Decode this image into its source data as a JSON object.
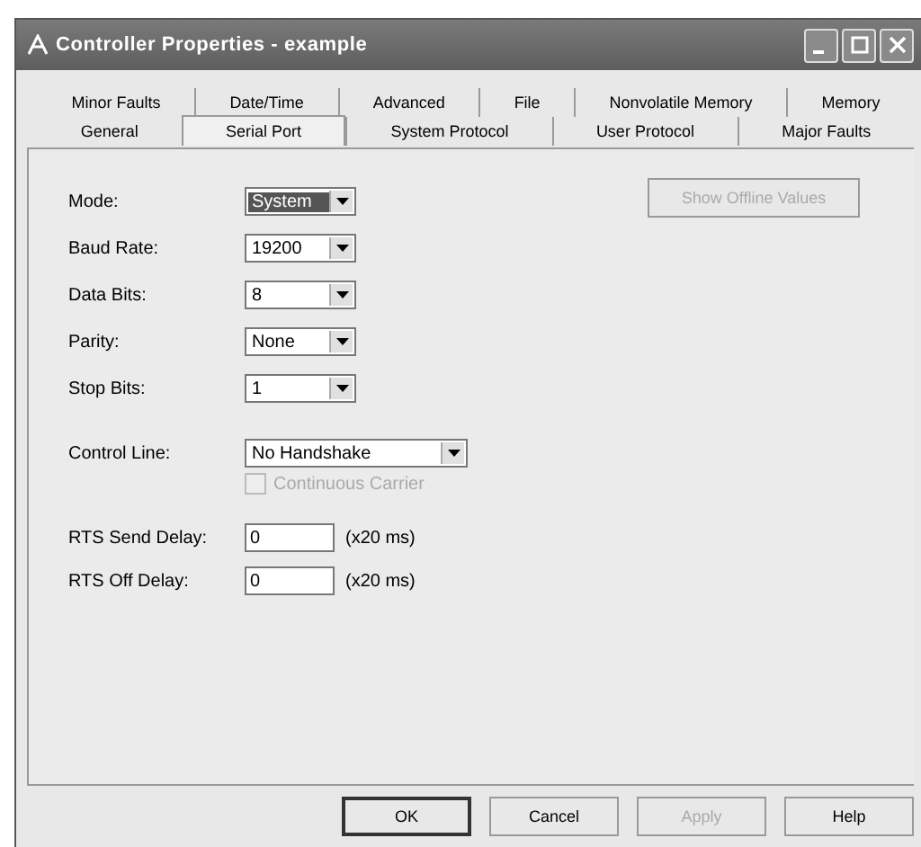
{
  "window": {
    "title": "Controller Properties - example"
  },
  "tab_rows": [
    [
      {
        "label": "Minor Faults",
        "selected": false
      },
      {
        "label": "Date/Time",
        "selected": false
      },
      {
        "label": "Advanced",
        "selected": false
      },
      {
        "label": "File",
        "selected": false
      },
      {
        "label": "Nonvolatile Memory",
        "selected": false
      },
      {
        "label": "Memory",
        "selected": false
      }
    ],
    [
      {
        "label": "General",
        "selected": false
      },
      {
        "label": "Serial Port",
        "selected": true
      },
      {
        "label": "System Protocol",
        "selected": false
      },
      {
        "label": "User Protocol",
        "selected": false
      },
      {
        "label": "Major Faults",
        "selected": false
      }
    ]
  ],
  "fields": [
    {
      "kind": "dropdown",
      "label": "Mode:",
      "value": "System",
      "selected": true
    },
    {
      "kind": "dropdown",
      "label": "Baud Rate:",
      "value": "19200",
      "selected": false
    },
    {
      "kind": "dropdown",
      "label": "Data Bits:",
      "value": "8",
      "selected": false
    },
    {
      "kind": "dropdown",
      "label": "Parity:",
      "value": "None",
      "selected": false
    },
    {
      "kind": "dropdown",
      "label": "Stop Bits:",
      "value": "1",
      "selected": false
    },
    {
      "kind": "combobox",
      "label": "Control Line:",
      "value": "No Handshake",
      "selected": false
    },
    {
      "kind": "checkbox",
      "label": "Continuous Carrier",
      "checked": false,
      "disabled": true
    },
    {
      "kind": "text",
      "label": "RTS Send Delay:",
      "value": "0",
      "unit": "(x20 ms)"
    },
    {
      "kind": "text",
      "label": "RTS Off Delay:",
      "value": "0",
      "unit": "(x20 ms)"
    }
  ],
  "side_button": {
    "label": "Show Offline Values",
    "disabled": true
  },
  "buttons": [
    {
      "label": "OK",
      "default": true,
      "disabled": false
    },
    {
      "label": "Cancel",
      "default": false,
      "disabled": false
    },
    {
      "label": "Apply",
      "default": false,
      "disabled": true
    },
    {
      "label": "Help",
      "default": false,
      "disabled": false
    }
  ]
}
